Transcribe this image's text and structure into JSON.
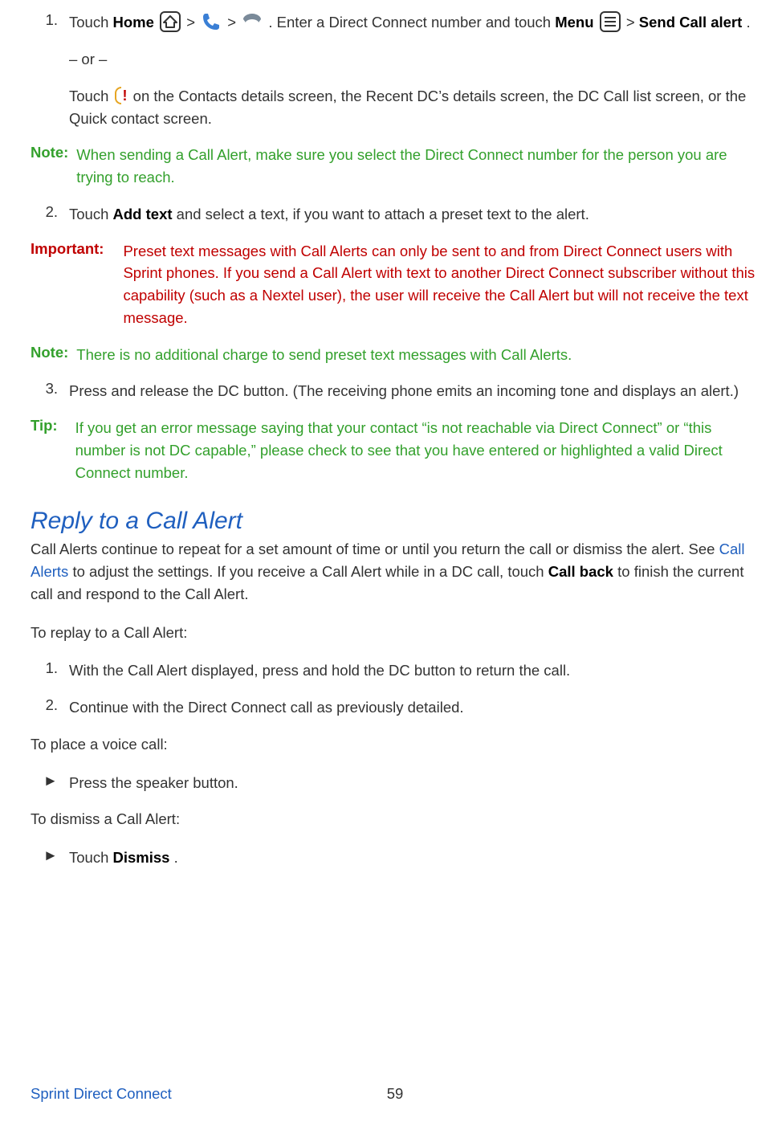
{
  "step1": {
    "num": "1.",
    "t1": "Touch ",
    "home": "Home",
    "t2": " > ",
    "t3": " > ",
    "t4": ". Enter a Direct Connect number and touch ",
    "menu": "Menu",
    "t5": " > ",
    "send": "Send Call alert",
    "t6": "."
  },
  "or": "– or –",
  "step1b": {
    "t1": "Touch ",
    "t2": " on the Contacts details screen, the Recent DC’s details screen, the DC Call list screen, or the Quick contact screen."
  },
  "note1": {
    "label": "Note:",
    "body": "When sending a Call Alert, make sure you select the Direct Connect number for the person you are trying to reach."
  },
  "step2": {
    "num": "2.",
    "t1": "Touch ",
    "bold": "Add text",
    "t2": " and select a text, if you want to attach a preset text to the alert."
  },
  "important": {
    "label": "Important:",
    "body": "Preset text messages with Call Alerts can only be sent to and from Direct Connect users with Sprint phones. If you send a Call Alert with text to another Direct Connect subscriber without this capability (such as a Nextel user), the user will receive the Call Alert but will not receive the text message."
  },
  "note2": {
    "label": "Note:",
    "body": "There is no additional charge to send preset text messages with Call Alerts."
  },
  "step3": {
    "num": "3.",
    "body": "Press and release the DC button. (The receiving phone emits an incoming tone and displays an alert.)"
  },
  "tip": {
    "label": "Tip:",
    "body": "If you get an error message saying that your contact “is not reachable via Direct Connect” or “this number is not DC capable,” please check to see that you have entered or highlighted a valid Direct Connect number."
  },
  "section": "Reply to a Call Alert",
  "intro": {
    "t1": "Call Alerts continue to repeat for a set amount of time or until you return the call or dismiss the alert. See ",
    "link": "Call Alerts",
    "t2": " to adjust the settings. If you receive a Call Alert while in a DC call, touch ",
    "bold": "Call back",
    "t3": " to finish the current call and respond to the Call Alert."
  },
  "replay": "To replay to a Call Alert:",
  "r1": {
    "num": "1.",
    "body": "With the Call Alert displayed, press and hold the DC button to return the call."
  },
  "r2": {
    "num": "2.",
    "body": "Continue with the Direct Connect call as previously detailed."
  },
  "voice": "To place a voice call:",
  "v1": {
    "arrow": "►",
    "body": "Press the speaker button."
  },
  "dismiss": "To dismiss a Call Alert:",
  "d1": {
    "arrow": "►",
    "t1": "Touch ",
    "bold": "Dismiss",
    "t2": "."
  },
  "footer": {
    "left": "Sprint Direct Connect",
    "page": "59"
  }
}
